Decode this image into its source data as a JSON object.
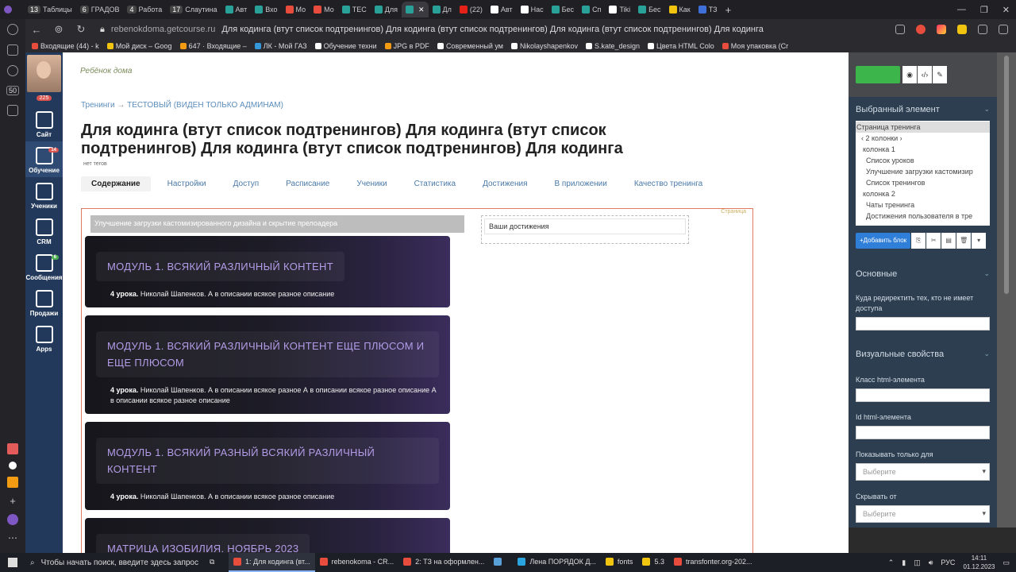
{
  "browser": {
    "tabs": [
      {
        "label": "Таблицы",
        "count": "13",
        "color": "#4caf50"
      },
      {
        "label": "ГРАДОВ",
        "count": "6",
        "color": "#888"
      },
      {
        "label": "Работа",
        "count": "4",
        "color": "#888"
      },
      {
        "label": "Слаутина",
        "count": "17",
        "color": "#888"
      },
      {
        "label": "Авт",
        "color": "#2aa198"
      },
      {
        "label": "Вхо",
        "color": "#2aa198"
      },
      {
        "label": "Мо",
        "color": "#e74c3c"
      },
      {
        "label": "Мо",
        "color": "#e74c3c"
      },
      {
        "label": "ТЕС",
        "color": "#2aa198"
      },
      {
        "label": "Для",
        "color": "#2aa198"
      },
      {
        "label": "",
        "color": "#2aa198",
        "active": true
      },
      {
        "label": "Дл",
        "color": "#2aa198"
      },
      {
        "label": "(22)",
        "color": "#e62117"
      },
      {
        "label": "Авт",
        "color": "#fff"
      },
      {
        "label": "Нас",
        "color": "#fff"
      },
      {
        "label": "Бес",
        "color": "#2aa198"
      },
      {
        "label": "Сп",
        "color": "#2aa198"
      },
      {
        "label": "Tiki",
        "color": "#fff"
      },
      {
        "label": "Бес",
        "color": "#2aa198"
      },
      {
        "label": "Как",
        "color": "#f1c40f"
      },
      {
        "label": "ТЗ",
        "color": "#3f6fd8"
      }
    ],
    "url_domain": "rebenokdoma.getcourse.ru",
    "url_title": "Для кодинга (втут список подтренингов) Для кодинга (втут список подтренингов) Для кодинга (втут список подтренингов) Для кодинга",
    "bookmarks": [
      {
        "label": "Входящие (44) - k",
        "color": "#e74c3c"
      },
      {
        "label": "Мой диск – Goog",
        "color": "#f1c40f"
      },
      {
        "label": "647 · Входящие –",
        "color": "#f39c12"
      },
      {
        "label": "ЛК - Мой ГАЗ",
        "color": "#3498db"
      },
      {
        "label": "Обучение техни",
        "color": "#fff"
      },
      {
        "label": "JPG в PDF",
        "color": "#f39c12"
      },
      {
        "label": "Современный ум",
        "color": "#fff"
      },
      {
        "label": "Nikolayshapenkov",
        "color": "#fff"
      },
      {
        "label": "S.kate_design",
        "color": "#fff"
      },
      {
        "label": "Цвета HTML Colo",
        "color": "#fff"
      },
      {
        "label": "Моя упаковка (Cr",
        "color": "#e74c3c"
      }
    ],
    "vstrip_badge": "50"
  },
  "sidebar": {
    "notif_count": "225",
    "items": [
      {
        "label": "Сайт",
        "badge": ""
      },
      {
        "label": "Обучение",
        "badge": "14",
        "active": true
      },
      {
        "label": "Ученики",
        "badge": ""
      },
      {
        "label": "CRM",
        "badge": ""
      },
      {
        "label": "Сообщения",
        "badge": "6"
      },
      {
        "label": "Продажи",
        "badge": ""
      },
      {
        "label": "Apps",
        "badge": ""
      }
    ]
  },
  "main": {
    "logo": "Ребёнок дома",
    "breadcrumb": {
      "root": "Тренинги",
      "arrow": "→",
      "current": "ТЕСТОВЫЙ (ВИДЕН ТОЛЬКО АДМИНАМ)"
    },
    "title": "Для кодинга (втут список подтренингов) Для кодинга (втут список подтренингов) Для кодинга (втут список подтренингов) Для кодинга",
    "tags": "нет тегов",
    "tabs": [
      "Содержание",
      "Настройки",
      "Доступ",
      "Расписание",
      "Ученики",
      "Статистика",
      "Достижения",
      "В приложении",
      "Качество тренинга"
    ],
    "frame_label": "Страница",
    "gray_bar": "Улучшение загрузки кастомизированного дизайна и скрытие прелоадера",
    "cards": [
      {
        "title": "МОДУЛЬ 1. ВСЯКИЙ РАЗЛИЧНЫЙ КОНТЕНТ",
        "lessons": "4 урока.",
        "desc": "Николай Шапенков. А в описании всякое разное описание"
      },
      {
        "title": "МОДУЛЬ 1. ВСЯКИЙ РАЗЛИЧНЫЙ КОНТЕНТ ЕЩЕ ПЛЮСОМ И ЕЩЕ ПЛЮСОМ",
        "lessons": "4 урока.",
        "desc": "Николай Шапенков. А в описании всякое разное А в описании всякое разное описание А в описании всякое разное описание"
      },
      {
        "title": "МОДУЛЬ 1. ВСЯКИЙ РАЗНЫЙ ВСЯКИЙ РАЗЛИЧНЫЙ КОНТЕНТ",
        "lessons": "4 урока.",
        "desc": "Николай Шапенков. А в описании всякое разное описание"
      },
      {
        "title": "МАТРИЦА ИЗОБИЛИЯ. НОЯБРЬ 2023",
        "lessons": "",
        "desc": ""
      }
    ],
    "achievements": "Ваши достижения"
  },
  "panel": {
    "selected_header": "Выбранный элемент",
    "tree": [
      "Страница тренинга",
      "‹ 2 колонки ›",
      "колонка 1",
      "Список уроков",
      "Улучшение загрузки кастомизир",
      "Список тренингов",
      "колонка 2",
      "Чаты тренинга",
      "Достижения пользователя в тре"
    ],
    "add_block": "+Добавить блок",
    "basic": "Основные",
    "redirect_label": "Куда редиректить тех, кто не имеет доступа",
    "visual": "Визуальные свойства",
    "class_label": "Класс html-элемента",
    "id_label": "Id html-элемента",
    "show_only": "Показывать только для",
    "hide_from": "Скрывать от",
    "select_placeholder": "Выберите"
  },
  "taskbar": {
    "search_placeholder": "Чтобы начать поиск, введите здесь запрос",
    "items": [
      {
        "label": "1: Для кодинга (вт...",
        "color": "#e74c3c",
        "active": true
      },
      {
        "label": "rebenokoma - CR...",
        "color": "#e74c3c"
      },
      {
        "label": "2: ТЗ на оформлен...",
        "color": "#e74c3c"
      },
      {
        "label": "",
        "color": "#5aa0d8"
      },
      {
        "label": "Лена ПОРЯДОК Д...",
        "color": "#2aa5e0"
      },
      {
        "label": "fonts",
        "color": "#f1c40f"
      },
      {
        "label": "5.3",
        "color": "#f1c40f"
      },
      {
        "label": "transfonter.org-202...",
        "color": "#e74c3c"
      }
    ],
    "lang": "РУС",
    "time": "14:11",
    "date": "01.12.2023"
  }
}
